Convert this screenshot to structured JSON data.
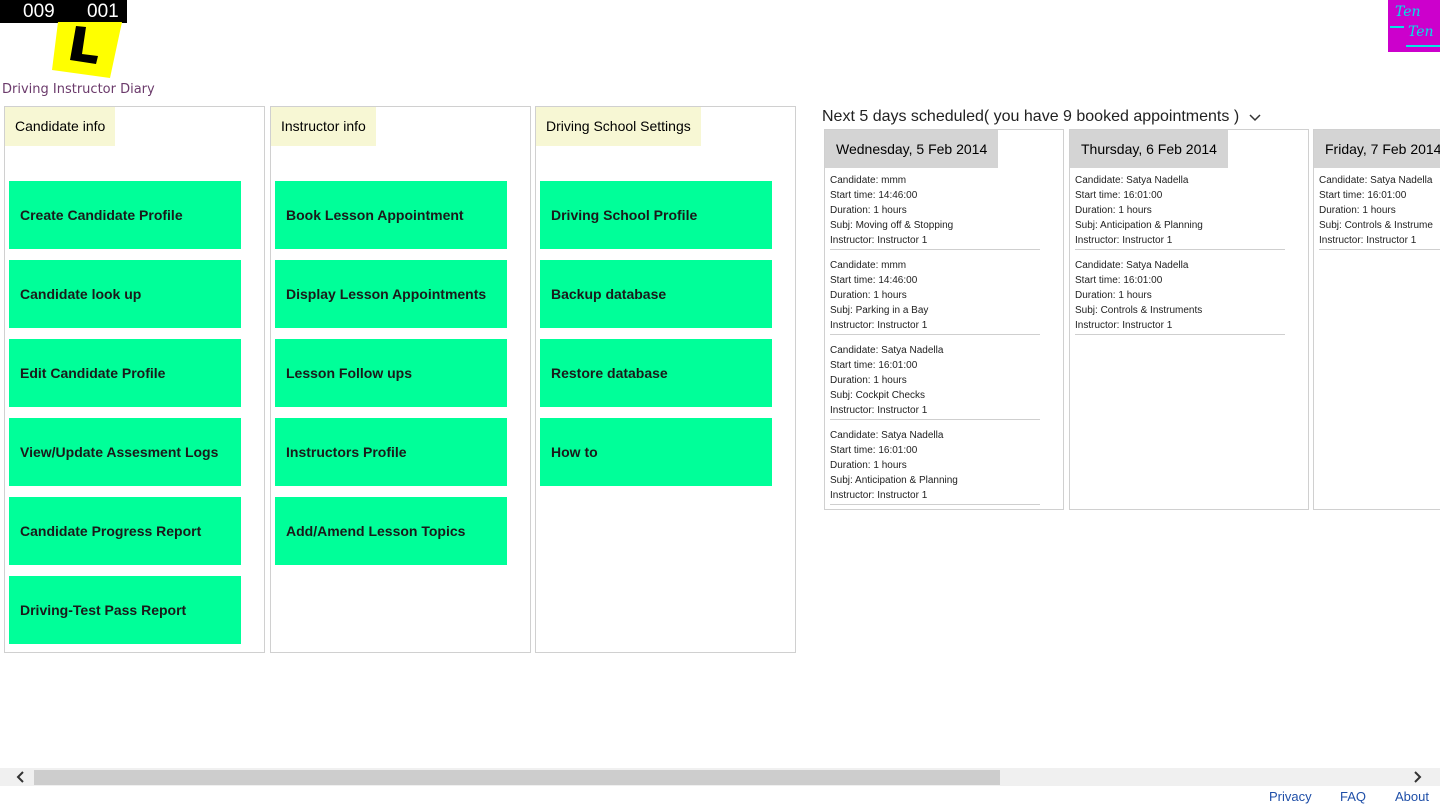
{
  "header": {
    "counter_left": "009",
    "counter_right": "001",
    "app_title": "Driving Instructor Diary",
    "brand_line1": "Ten",
    "brand_line2": "Ten"
  },
  "panels": [
    {
      "title": "Candidate info",
      "tiles": [
        "Create Candidate Profile",
        "Candidate look up",
        "Edit Candidate Profile",
        "View/Update Assesment Logs",
        "Candidate Progress Report",
        "Driving-Test Pass Report"
      ]
    },
    {
      "title": "Instructor info",
      "tiles": [
        "Book Lesson Appointment",
        "Display Lesson Appointments",
        "Lesson Follow ups",
        "Instructors Profile",
        "Add/Amend Lesson Topics"
      ]
    },
    {
      "title": "Driving School Settings",
      "tiles": [
        "Driving School Profile",
        "Backup database",
        "Restore database",
        "How to"
      ]
    }
  ],
  "schedule": {
    "title": "Next 5 days scheduled( you have 9 booked appointments )",
    "days": [
      {
        "date": "Wednesday, 5 Feb 2014",
        "appointments": [
          {
            "candidate": "Candidate: mmm",
            "start": "Start time: 14:46:00",
            "duration": "Duration: 1 hours",
            "subj": "Subj: Moving off & Stopping",
            "instructor": "Instructor: Instructor 1"
          },
          {
            "candidate": "Candidate: mmm",
            "start": "Start time: 14:46:00",
            "duration": "Duration: 1 hours",
            "subj": "Subj: Parking in a Bay",
            "instructor": "Instructor: Instructor 1"
          },
          {
            "candidate": "Candidate: Satya Nadella",
            "start": "Start time: 16:01:00",
            "duration": "Duration: 1 hours",
            "subj": "Subj: Cockpit Checks",
            "instructor": "Instructor: Instructor 1"
          },
          {
            "candidate": "Candidate: Satya Nadella",
            "start": "Start time: 16:01:00",
            "duration": "Duration: 1 hours",
            "subj": "Subj: Anticipation & Planning",
            "instructor": "Instructor: Instructor 1"
          }
        ]
      },
      {
        "date": "Thursday, 6 Feb 2014",
        "appointments": [
          {
            "candidate": "Candidate: Satya Nadella",
            "start": "Start time: 16:01:00",
            "duration": "Duration: 1 hours",
            "subj": "Subj: Anticipation & Planning",
            "instructor": "Instructor: Instructor 1"
          },
          {
            "candidate": "Candidate: Satya Nadella",
            "start": "Start time: 16:01:00",
            "duration": "Duration: 1 hours",
            "subj": "Subj: Controls & Instruments",
            "instructor": "Instructor: Instructor 1"
          }
        ]
      },
      {
        "date": "Friday, 7 Feb 2014",
        "appointments": [
          {
            "candidate": "Candidate: Satya Nadella",
            "start": "Start time: 16:01:00",
            "duration": "Duration: 1 hours",
            "subj": "Subj: Controls & Instrume",
            "instructor": "Instructor: Instructor 1"
          }
        ]
      }
    ]
  },
  "footer": {
    "privacy": "Privacy",
    "faq": "FAQ",
    "about": "About"
  },
  "colors": {
    "tile": "#00ff99",
    "panel_header": "#f7f7d4",
    "day_header": "#d4d4d4",
    "brand": "#cc00cc",
    "logo": "#ffff00"
  }
}
